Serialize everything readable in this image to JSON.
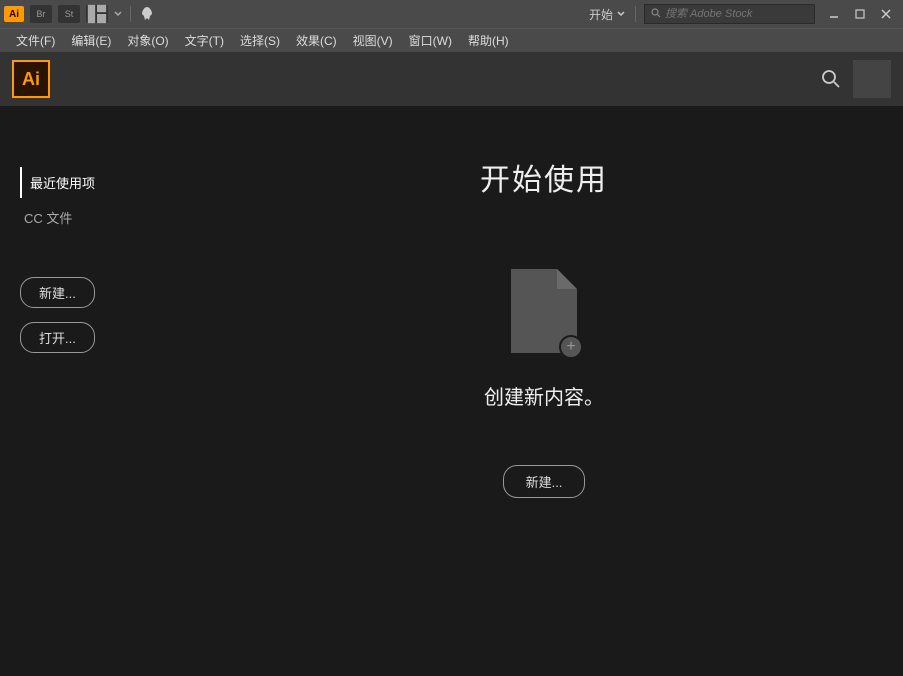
{
  "titlebar": {
    "logo": "Ai",
    "icon_br": "Br",
    "icon_st": "St",
    "start_label": "开始",
    "search_placeholder": "搜索 Adobe Stock"
  },
  "menu": {
    "file": "文件(F)",
    "edit": "编辑(E)",
    "object": "对象(O)",
    "type": "文字(T)",
    "select": "选择(S)",
    "effect": "效果(C)",
    "view": "视图(V)",
    "window": "窗口(W)",
    "help": "帮助(H)"
  },
  "toolbar": {
    "logo": "Ai"
  },
  "sidebar": {
    "recent": "最近使用项",
    "ccfiles": "CC 文件",
    "new_btn": "新建...",
    "open_btn": "打开..."
  },
  "content": {
    "title": "开始使用",
    "create_text": "创建新内容。",
    "new_btn": "新建..."
  }
}
